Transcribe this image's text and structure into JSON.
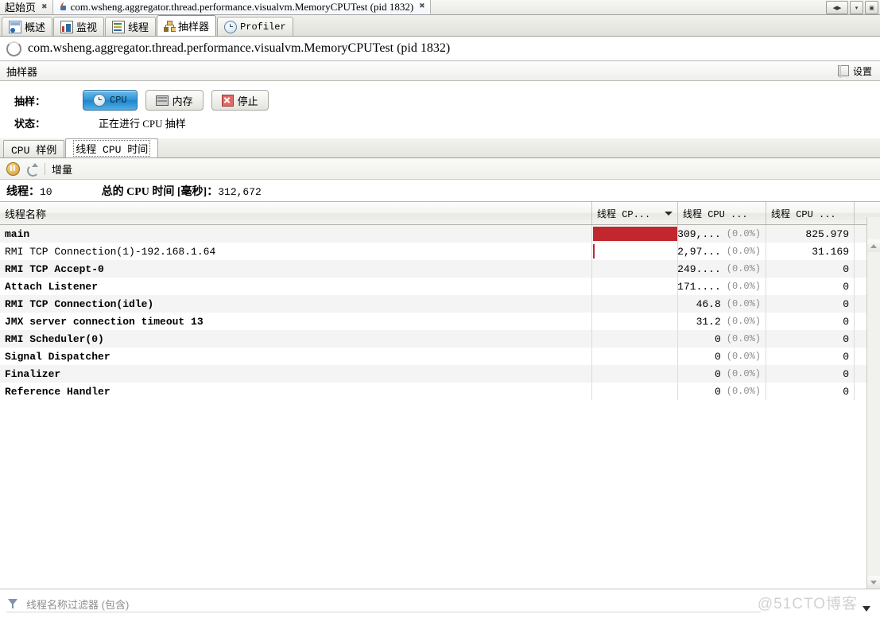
{
  "window": {
    "tabs": [
      {
        "label": "起始页",
        "icon": "none",
        "active": false,
        "closable": true
      },
      {
        "label": "com.wsheng.aggregator.thread.performance.visualvm.MemoryCPUTest (pid 1832)",
        "icon": "java-icon",
        "active": true,
        "closable": true
      }
    ],
    "buttons": [
      "prev-next",
      "dropdown",
      "maximize"
    ]
  },
  "view_tabs": [
    {
      "label": "概述",
      "icon": "overview-icon",
      "active": false
    },
    {
      "label": "监视",
      "icon": "monitor-icon",
      "active": false
    },
    {
      "label": "线程",
      "icon": "threads-icon",
      "active": false
    },
    {
      "label": "抽样器",
      "icon": "sampler-icon",
      "active": true
    },
    {
      "label": "Profiler",
      "icon": "profiler-icon",
      "active": false
    }
  ],
  "process": {
    "title": "com.wsheng.aggregator.thread.performance.visualvm.MemoryCPUTest (pid 1832)",
    "icon": "loading-spinner-icon"
  },
  "panel": {
    "title": "抽样器",
    "settings_label": "设置",
    "settings_checked": false
  },
  "sampling": {
    "label": "抽样：",
    "buttons": [
      {
        "label": "CPU",
        "icon": "clock-icon",
        "state": "selected"
      },
      {
        "label": "内存",
        "icon": "memory-icon",
        "state": "normal"
      },
      {
        "label": "停止",
        "icon": "stop-icon",
        "state": "normal"
      }
    ],
    "status_label": "状态：",
    "status_value": "正在进行 CPU 抽样"
  },
  "inner_tabs": [
    {
      "label": "CPU 样例",
      "active": false
    },
    {
      "label": "线程 CPU 时间",
      "active": true
    }
  ],
  "toolbar": {
    "pause_icon": "pause-icon",
    "refresh_icon": "refresh-icon",
    "delta_label": "增量"
  },
  "summary": {
    "threads_label": "线程：",
    "threads_value": "10",
    "total_cpu_label": "总的 CPU 时间 [毫秒]：",
    "total_cpu_value": "312,672"
  },
  "table": {
    "columns": [
      {
        "key": "name",
        "label": "线程名称",
        "sorted": false
      },
      {
        "key": "bar",
        "label": "",
        "sorted": false
      },
      {
        "key": "cpu_time",
        "label": "线程 CP...",
        "sorted": true,
        "sort_dir": "desc"
      },
      {
        "key": "cpu_time2",
        "label": "线程 CPU ...",
        "sorted": false
      },
      {
        "key": "blocked",
        "label": "线程 CPU ...",
        "sorted": false
      }
    ],
    "rows": [
      {
        "name": "main",
        "bold": true,
        "bar_pct": 100,
        "cpu": "309,...",
        "pct": "(0.0%)",
        "blocked": "825.979"
      },
      {
        "name": "RMI TCP Connection(1)-192.168.1.64",
        "bold": false,
        "bar_pct": 1,
        "cpu": "2,97...",
        "pct": "(0.0%)",
        "blocked": "31.169"
      },
      {
        "name": "RMI TCP Accept-0",
        "bold": true,
        "bar_pct": 0,
        "cpu": "249....",
        "pct": "(0.0%)",
        "blocked": "0"
      },
      {
        "name": "Attach Listener",
        "bold": true,
        "bar_pct": 0,
        "cpu": "171....",
        "pct": "(0.0%)",
        "blocked": "0"
      },
      {
        "name": "RMI TCP Connection(idle)",
        "bold": true,
        "bar_pct": 0,
        "cpu": "46.8",
        "pct": "(0.0%)",
        "blocked": "0"
      },
      {
        "name": "JMX server connection timeout 13",
        "bold": true,
        "bar_pct": 0,
        "cpu": "31.2",
        "pct": "(0.0%)",
        "blocked": "0"
      },
      {
        "name": "RMI Scheduler(0)",
        "bold": true,
        "bar_pct": 0,
        "cpu": "0",
        "pct": "(0.0%)",
        "blocked": "0"
      },
      {
        "name": "Signal Dispatcher",
        "bold": true,
        "bar_pct": 0,
        "cpu": "0",
        "pct": "(0.0%)",
        "blocked": "0"
      },
      {
        "name": "Finalizer",
        "bold": true,
        "bar_pct": 0,
        "cpu": "0",
        "pct": "(0.0%)",
        "blocked": "0"
      },
      {
        "name": "Reference Handler",
        "bold": true,
        "bar_pct": 0,
        "cpu": "0",
        "pct": "(0.0%)",
        "blocked": "0"
      }
    ],
    "bar_color": "#c1272d"
  },
  "footer": {
    "filter_icon": "filter-icon",
    "filter_placeholder": "线程名称过滤器 (包含)",
    "watermark": "@51CTO博客"
  }
}
